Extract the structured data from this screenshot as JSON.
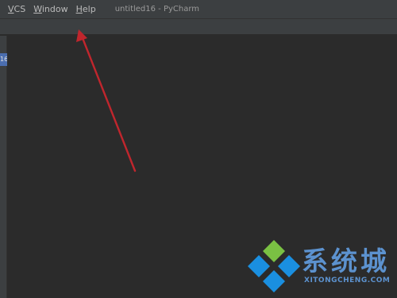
{
  "menubar": {
    "items": [
      {
        "label": "VCS"
      },
      {
        "label": "Window"
      },
      {
        "label": "Help"
      }
    ],
    "window_title": "untitled16 - PyCharm"
  },
  "left_strip": {
    "tab_label": "16"
  },
  "watermark": {
    "cn_text": "系统城",
    "en_text": "XITONGCHENG.COM"
  },
  "colors": {
    "annotation_arrow": "#c0262d",
    "watermark_blue": "#1a8fe0",
    "watermark_green": "#7ac143"
  }
}
